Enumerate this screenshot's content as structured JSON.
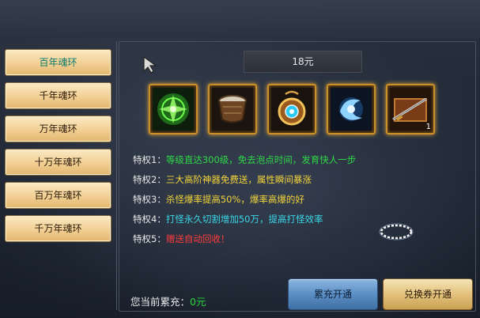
{
  "sidebar": {
    "items": [
      {
        "label": "百年魂环",
        "active": true
      },
      {
        "label": "千年魂环",
        "active": false
      },
      {
        "label": "万年魂环",
        "active": false
      },
      {
        "label": "十万年魂环",
        "active": false
      },
      {
        "label": "百万年魂环",
        "active": false
      },
      {
        "label": "千万年魂环",
        "active": false
      }
    ]
  },
  "price": "18元",
  "rewards": [
    {
      "icon": "green-rune-icon",
      "count": ""
    },
    {
      "icon": "drum-icon",
      "count": ""
    },
    {
      "icon": "gold-amulet-icon",
      "count": ""
    },
    {
      "icon": "blue-orb-icon",
      "count": ""
    },
    {
      "icon": "weapon-chest-icon",
      "count": "1"
    }
  ],
  "privileges": [
    {
      "label": "特权1：",
      "text": "等级直达300级，免去泡点时间，发育快人一步",
      "color": "#2fd847"
    },
    {
      "label": "特权2：",
      "text": "三大高阶神器免费送，属性瞬间暴涨",
      "color": "#f2d43a"
    },
    {
      "label": "特权3：",
      "text": "杀怪爆率提高50%，爆率高爆的好",
      "color": "#f2d43a"
    },
    {
      "label": "特权4：",
      "text": "打怪永久切割增加50万，提高打怪效率",
      "color": "#3ad8e8"
    },
    {
      "label": "特权5：",
      "text": "赠送自动回收！",
      "color": "#ff3b3b"
    }
  ],
  "accumulated": {
    "label": "您当前累充：",
    "value": "0元"
  },
  "buttons": {
    "recharge": "累充开通",
    "voucher": "兑换券开通"
  }
}
